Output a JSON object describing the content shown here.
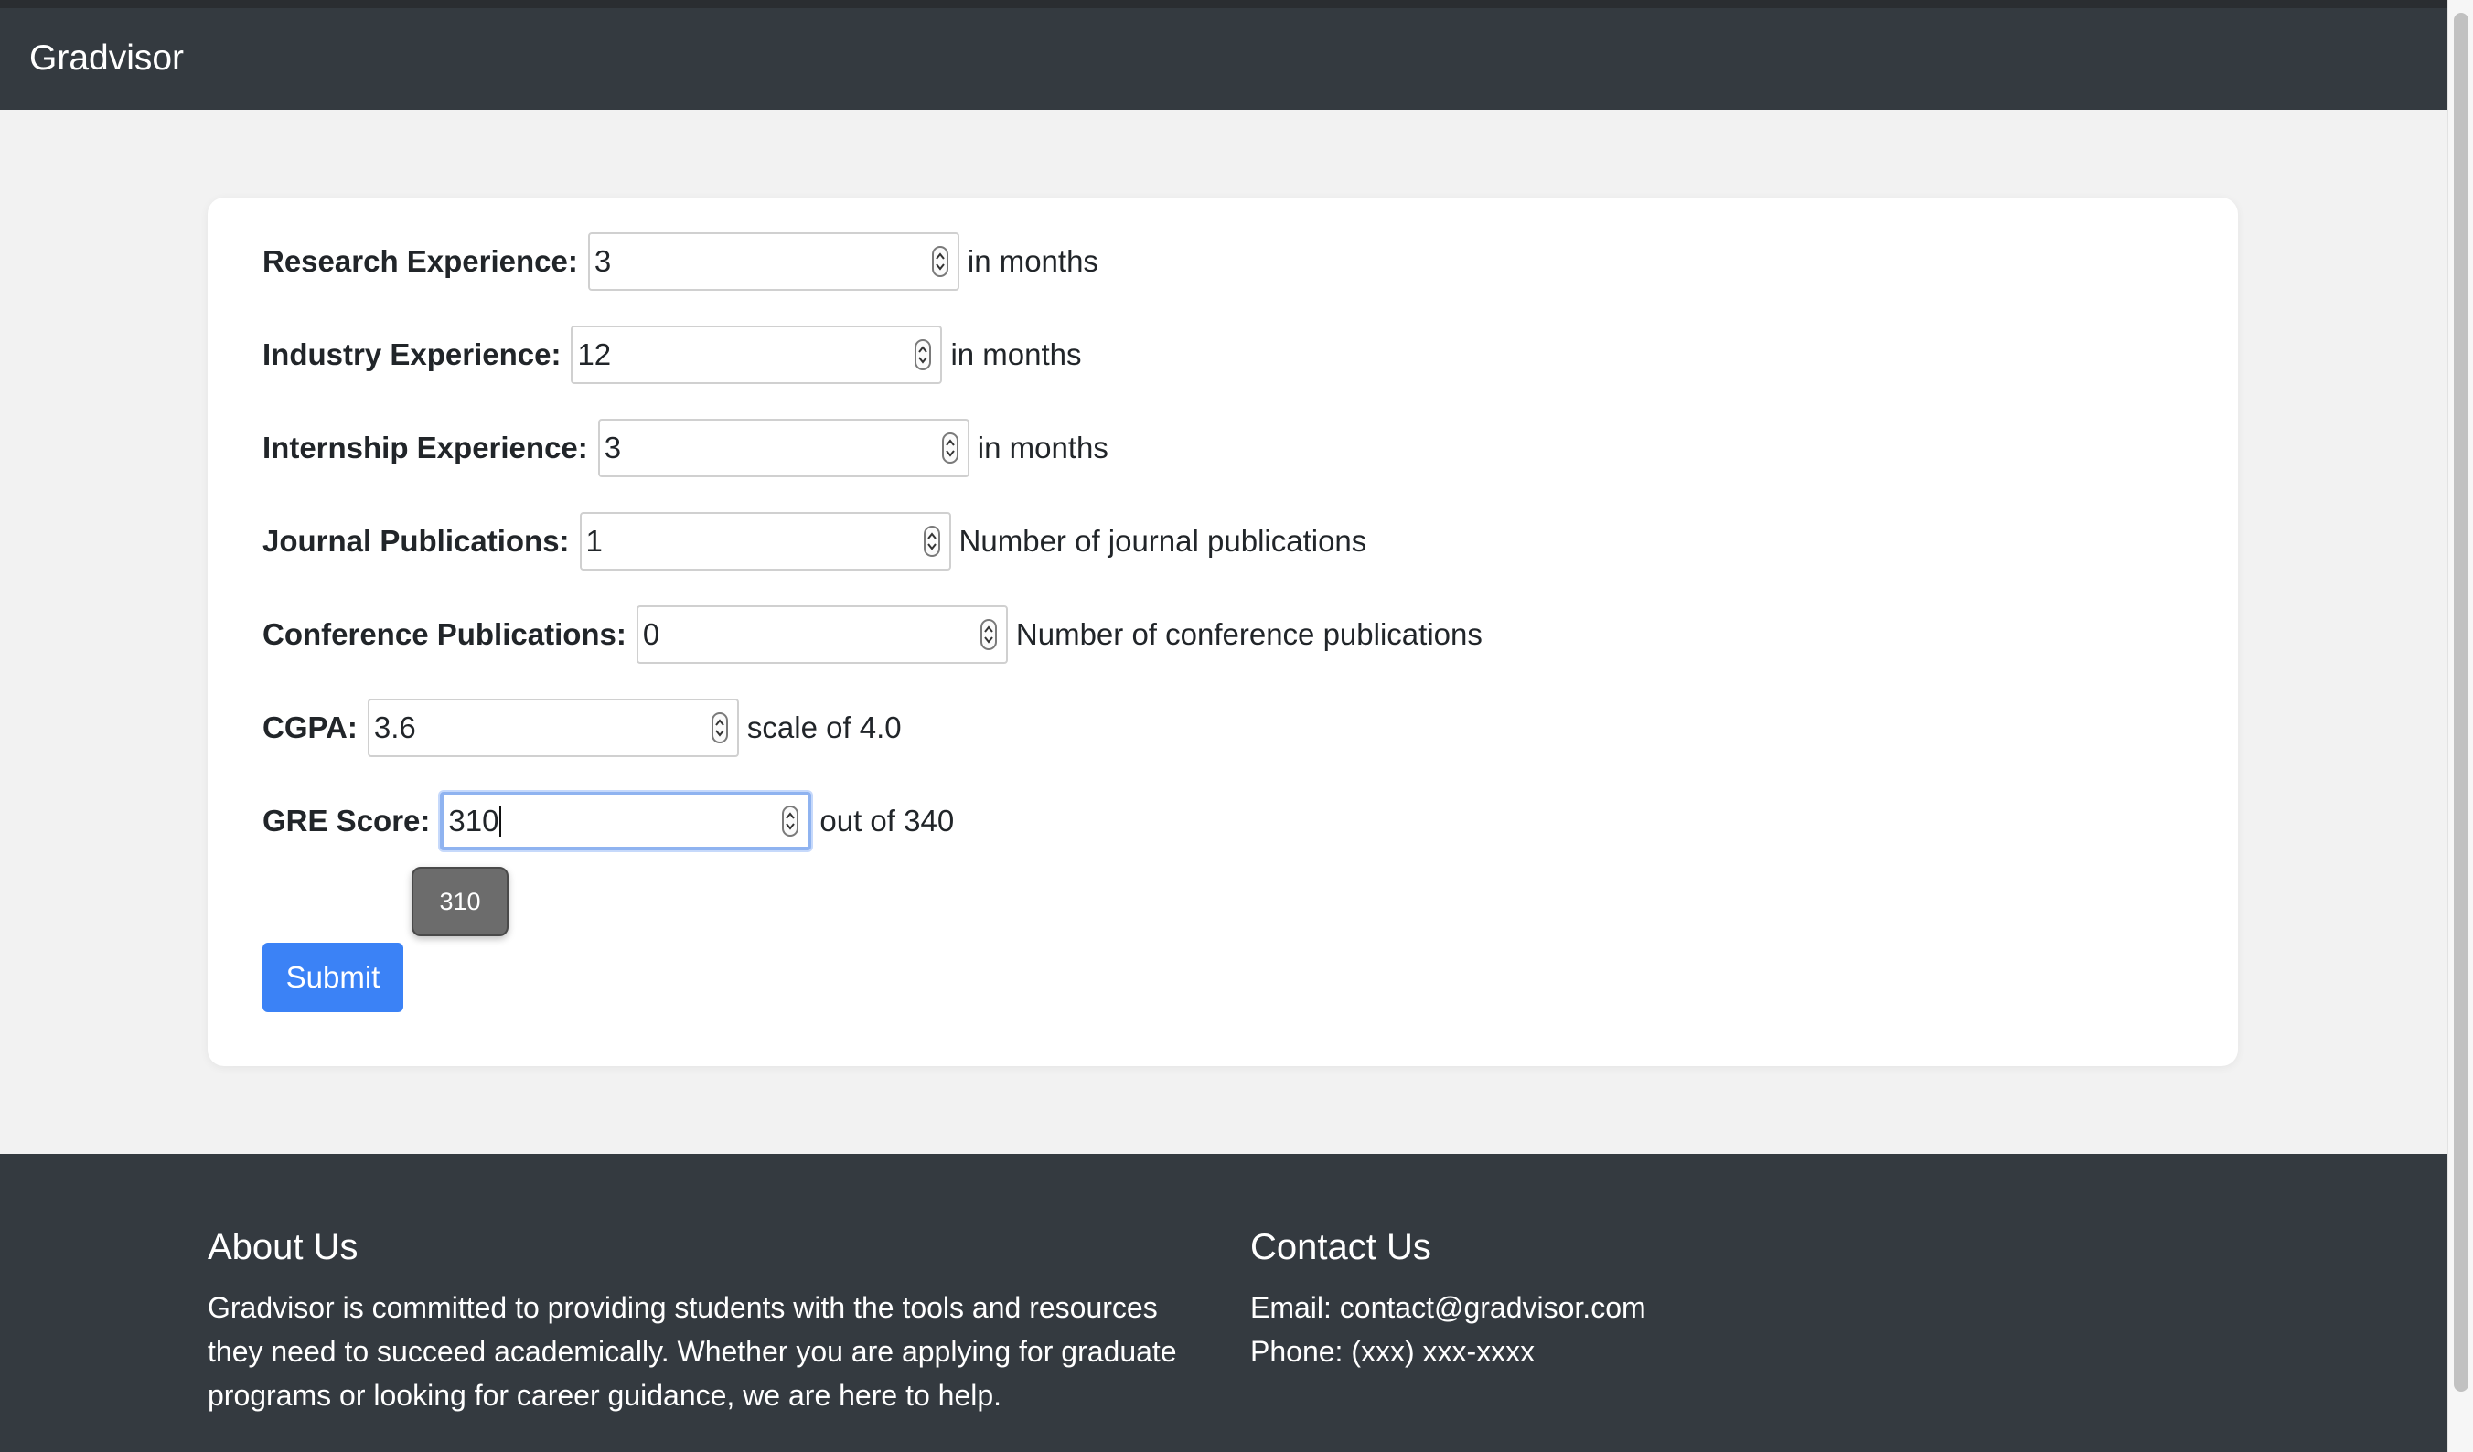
{
  "navbar": {
    "brand": "Gradvisor"
  },
  "form": {
    "fields": [
      {
        "label": "Research Experience:",
        "value": "3",
        "hint": "in months"
      },
      {
        "label": "Industry Experience:",
        "value": "12",
        "hint": "in months"
      },
      {
        "label": "Internship Experience:",
        "value": "3",
        "hint": "in months"
      },
      {
        "label": "Journal Publications:",
        "value": "1",
        "hint": "Number of journal publications"
      },
      {
        "label": "Conference Publications:",
        "value": "0",
        "hint": "Number of conference publications"
      },
      {
        "label": "CGPA:",
        "value": "3.6",
        "hint": "scale of 4.0"
      },
      {
        "label": "GRE Score:",
        "value": "310",
        "hint": "out of 340"
      }
    ],
    "autocomplete_suggestion": "310",
    "submit_label": "Submit"
  },
  "footer": {
    "about_title": "About Us",
    "about_text": "Gradvisor is committed to providing students with the tools and resources they need to succeed academically. Whether you are applying for graduate programs or looking for career guidance, we are here to help.",
    "contact_title": "Contact Us",
    "contact_email": "Email: contact@gradvisor.com",
    "contact_phone": "Phone: (xxx) xxx-xxxx"
  },
  "colors": {
    "navbar_bg": "#343a40",
    "page_bg": "#f2f2f2",
    "button_bg": "#3b82f6",
    "focus_ring": "#8fb3f0"
  }
}
